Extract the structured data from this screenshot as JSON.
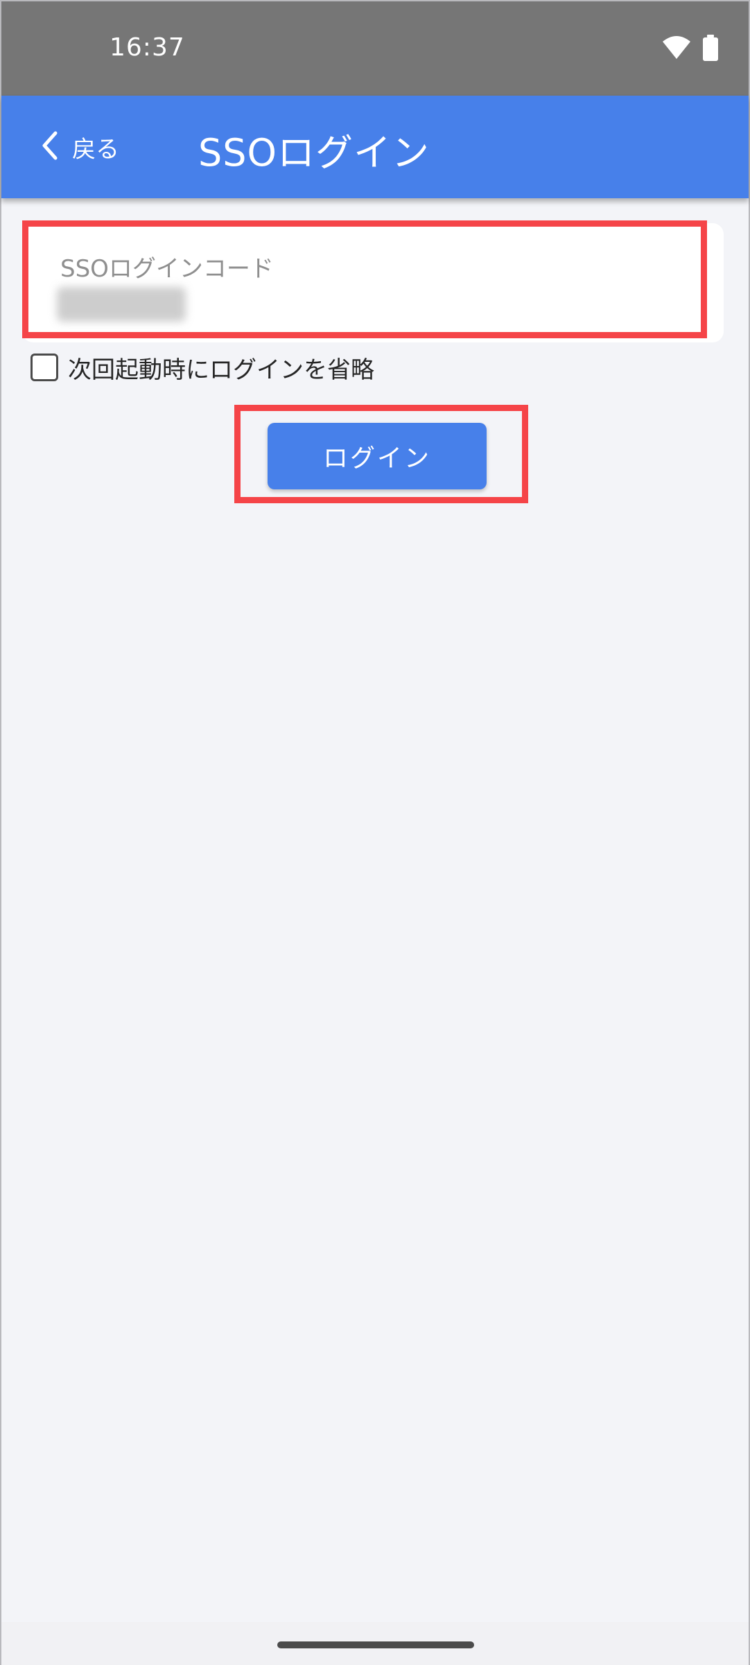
{
  "status_bar": {
    "time": "16:37",
    "icons": [
      "wifi-icon",
      "battery-icon"
    ]
  },
  "app_bar": {
    "back_label": "戻る",
    "title": "SSOログイン",
    "color": "#4780ea"
  },
  "sso_field": {
    "label": "SSOログインコード",
    "value": ""
  },
  "remember": {
    "label": "次回起動時にログインを省略",
    "checked": false
  },
  "login_button": {
    "label": "ログイン"
  },
  "highlight_color": "#f54448"
}
